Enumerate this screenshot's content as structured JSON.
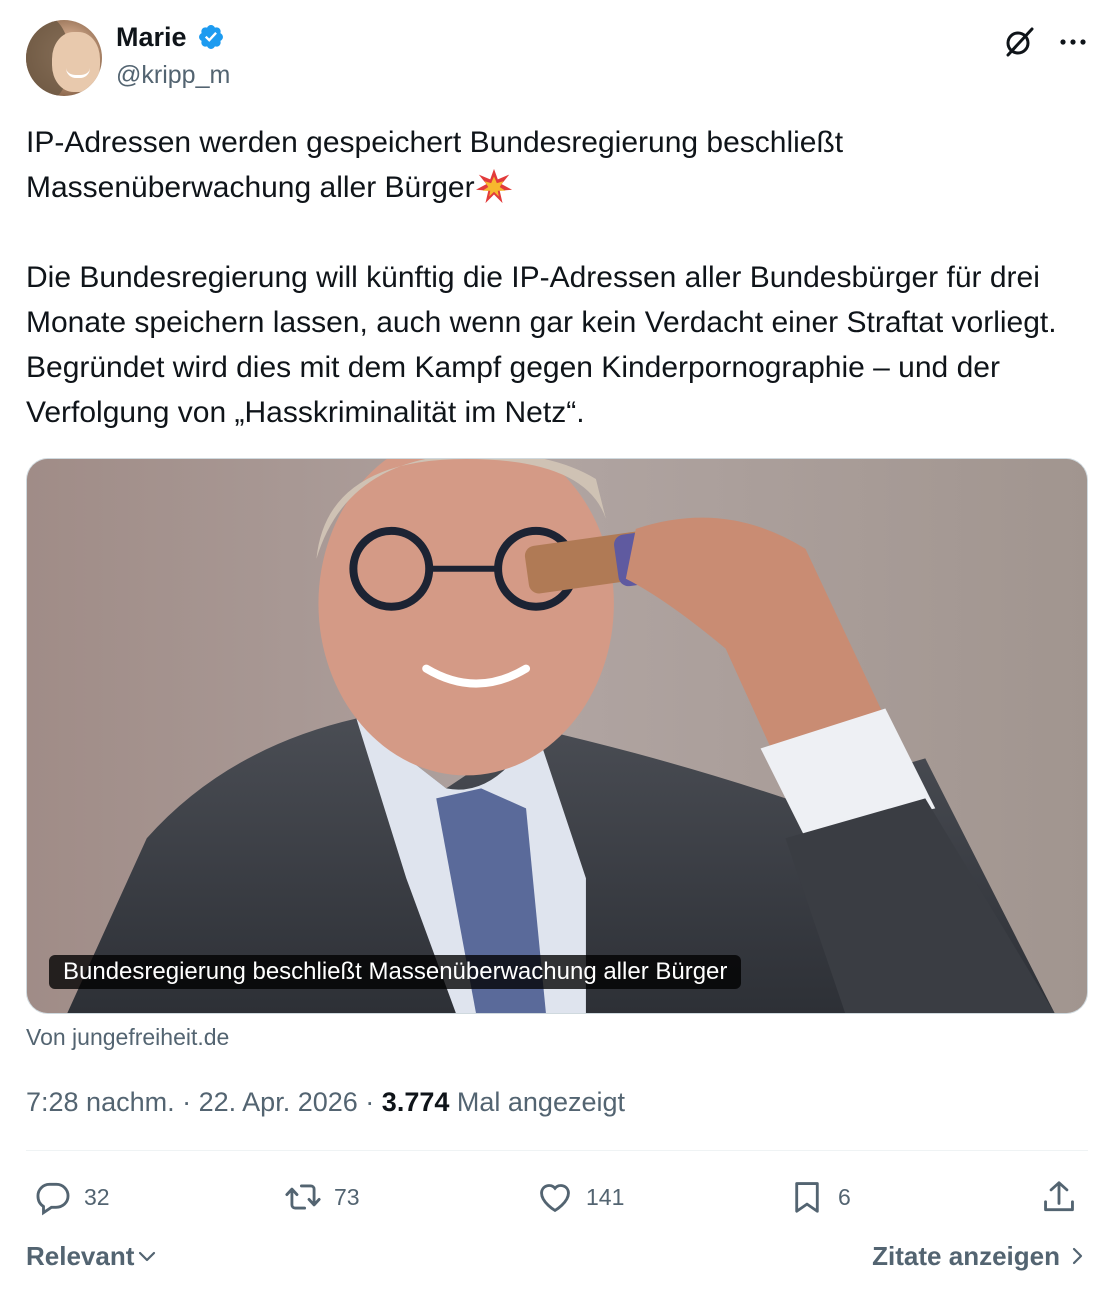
{
  "author": {
    "display_name": "Marie",
    "handle": "@kripp_m",
    "verified": true
  },
  "tweet": {
    "paragraph1": "IP-Adressen werden gespeichert Bundesregierung beschließt Massenüberwachung aller Bürger",
    "paragraph1_emoji": "collision-emoji",
    "paragraph2": "Die Bundesregierung will künftig die IP-Adressen aller Bundesbürger für drei Monate speichern lassen, auch wenn gar kein Verdacht einer Straftat vorliegt. Begründet wird dies mit dem Kampf gegen Kinderpornographie – und der Verfolgung von „Hasskriminalität im Netz“."
  },
  "card": {
    "caption": "Bundesregierung beschließt Massenüberwachung aller Bürger",
    "source": "Von jungefreiheit.de"
  },
  "meta": {
    "time": "7:28 nachm.",
    "separator": "·",
    "date": "22. Apr. 2026",
    "views_count": "3.774",
    "views_label": "Mal angezeigt"
  },
  "actions": {
    "replies": "32",
    "reposts": "73",
    "likes": "141",
    "bookmarks": "6"
  },
  "footer": {
    "sort_label": "Relevant",
    "quotes_label": "Zitate anzeigen"
  },
  "colors": {
    "text": "#0f1419",
    "secondary": "#536471",
    "verified": "#1d9bf0"
  }
}
